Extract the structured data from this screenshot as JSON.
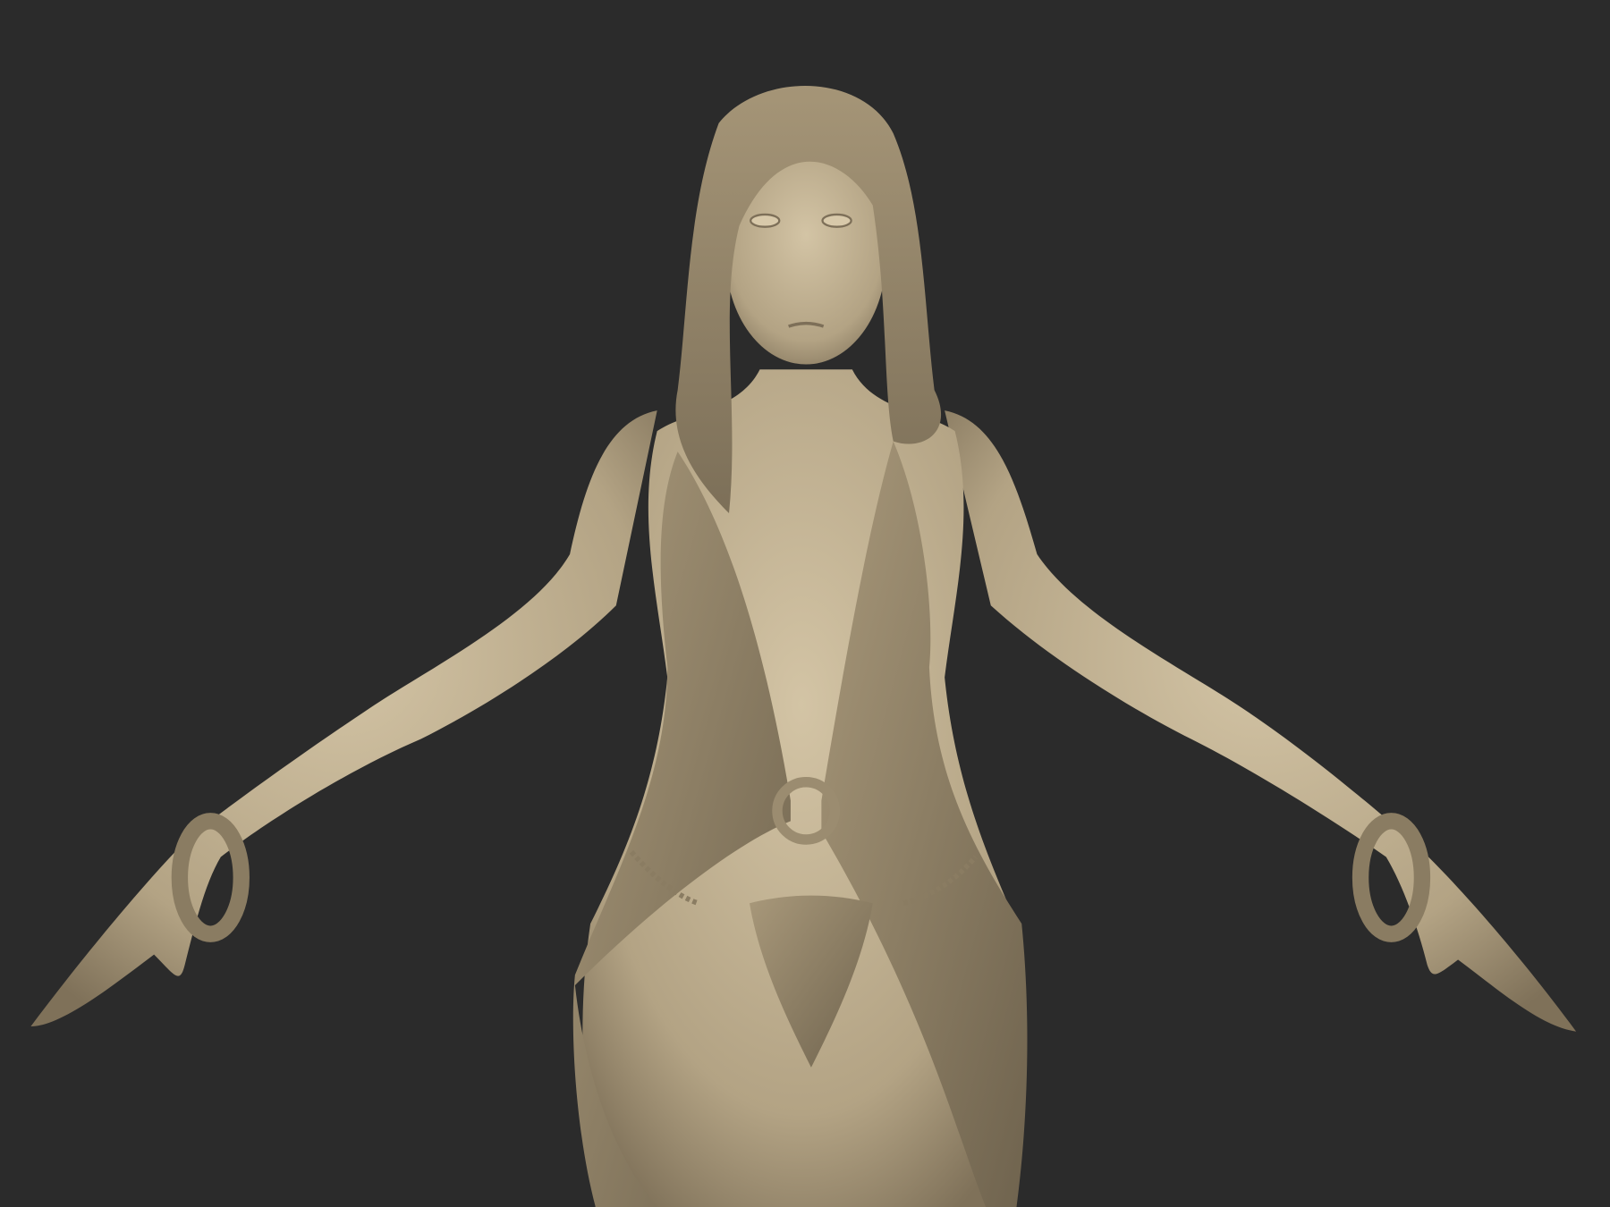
{
  "scene": {
    "background_color": "#2b2b2b",
    "clay_color": "#b9a98b",
    "clay_shadow_color": "#7d6f58",
    "clay_highlight_color": "#d6c7a8"
  }
}
